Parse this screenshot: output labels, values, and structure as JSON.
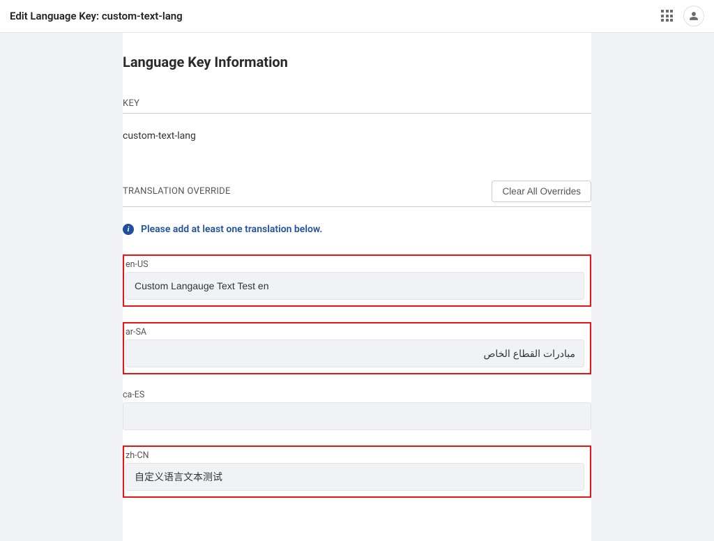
{
  "header": {
    "title": "Edit Language Key: custom-text-lang"
  },
  "main": {
    "heading": "Language Key Information",
    "key_label": "KEY",
    "key_value": "custom-text-lang",
    "override_label": "TRANSLATION OVERRIDE",
    "clear_button": "Clear All Overrides",
    "info_message": "Please add at least one translation below.",
    "locales": {
      "en_US": {
        "label": "en-US",
        "value": "Custom Langauge Text Test en"
      },
      "ar_SA": {
        "label": "ar-SA",
        "value": "مبادرات القطاع الخاص"
      },
      "ca_ES": {
        "label": "ca-ES",
        "value": ""
      },
      "zh_CN": {
        "label": "zh-CN",
        "value": "自定义语言文本测试"
      }
    }
  }
}
